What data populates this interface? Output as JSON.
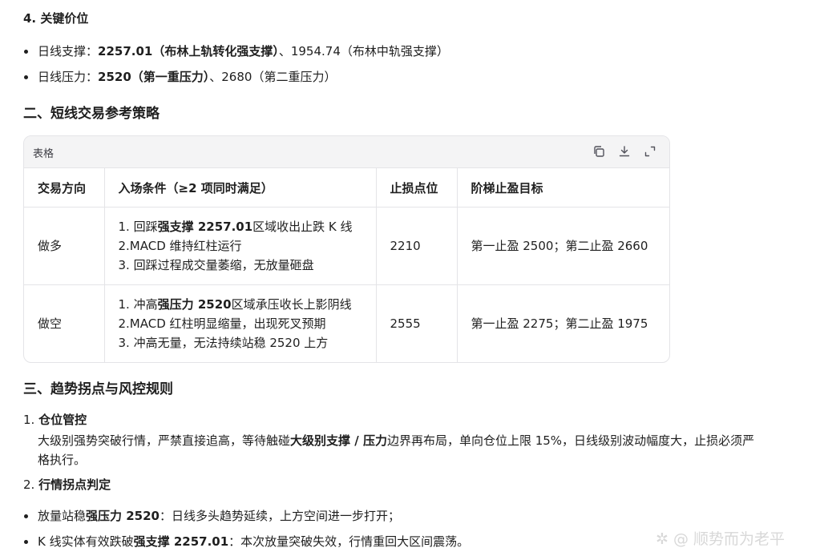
{
  "sec4": {
    "title": "4. 关键价位"
  },
  "levels": [
    {
      "prefix": "日线支撑：",
      "bold": "2257.01（布林上轨转化强支撑）",
      "rest": "、1954.74（布林中轨强支撑）"
    },
    {
      "prefix": "日线压力：",
      "bold": "2520（第一重压力）",
      "rest": "、2680（第二重压力）"
    }
  ],
  "sec2": {
    "title": "二、短线交易参考策略"
  },
  "table": {
    "label": "表格",
    "headers": [
      "交易方向",
      "入场条件（≥2 项同时满足）",
      "止损点位",
      "阶梯止盈目标"
    ],
    "rows": [
      {
        "direction": "做多",
        "c1_pre": "1. 回踩",
        "c1_bold": "强支撑 2257.01",
        "c1_post": "区域收出止跌 K 线",
        "c2": "2.MACD 维持红柱运行",
        "c3": "3. 回踩过程成交量萎缩，无放量砸盘",
        "stop": "2210",
        "target": "第一止盈 2500；第二止盈 2660"
      },
      {
        "direction": "做空",
        "c1_pre": "1. 冲高",
        "c1_bold": "强压力 2520",
        "c1_post": "区域承压收长上影阴线",
        "c2": "2.MACD 红柱明显缩量，出现死叉预期",
        "c3": "3. 冲高无量，无法持续站稳 2520 上方",
        "stop": "2555",
        "target": "第一止盈 2275；第二止盈 1975"
      }
    ]
  },
  "sec3": {
    "title": "三、趋势拐点与风控规则"
  },
  "rules": {
    "r1_title": "仓位管控",
    "r1_pre": "大级别强势突破行情，严禁直接追高，等待触碰",
    "r1_bold": "大级别支撑 / 压力",
    "r1_post": "边界再布局，单向仓位上限 15%，日线级别波动幅度大，止损必须严",
    "r1_line2": "格执行。",
    "r2_title": "行情拐点判定",
    "b1_pre": "放量站稳",
    "b1_bold": "强压力 2520",
    "b1_post": "：日线多头趋势延续，上方空间进一步打开；",
    "b2_pre": "K 线实体有效跌破",
    "b2_bold": "强支撑 2257.01",
    "b2_post": "：本次放量突破失效，行情重回大区间震荡。"
  },
  "watermark": "顺势而为老平"
}
